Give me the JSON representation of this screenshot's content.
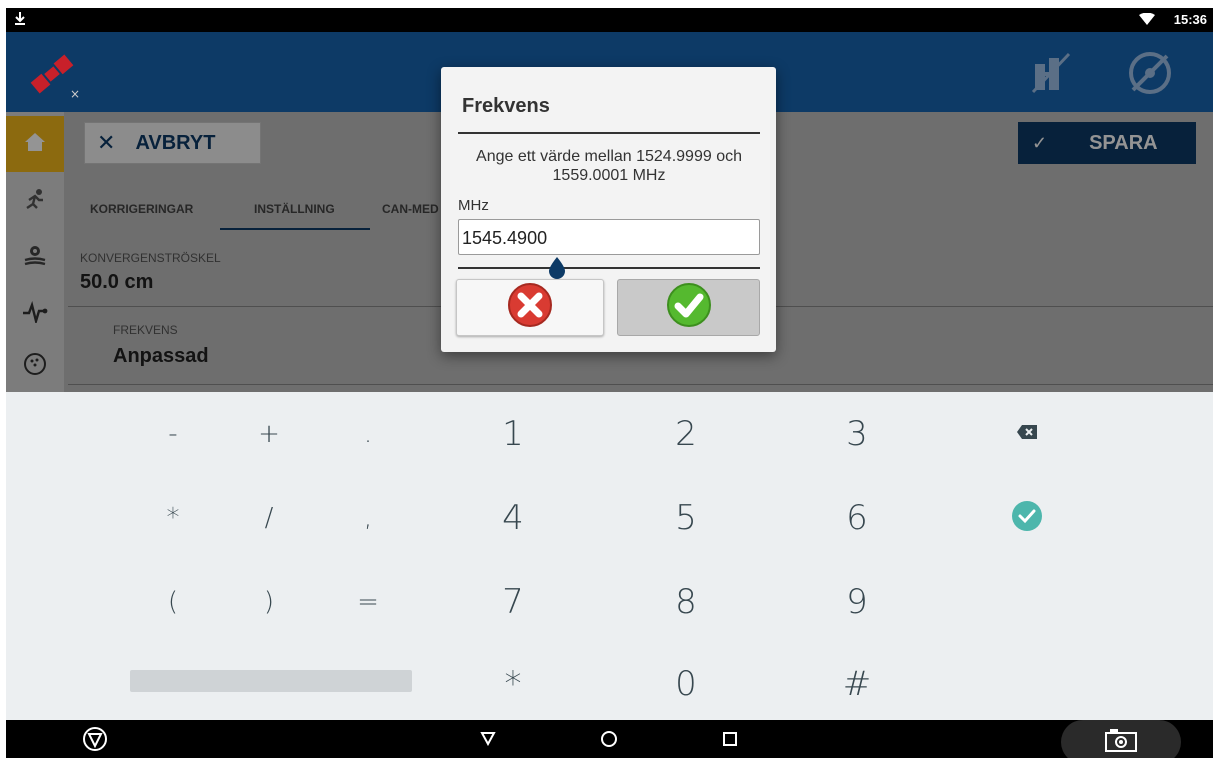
{
  "status_bar": {
    "time": "15:36"
  },
  "toolbar": {
    "cancel_label": "AVBRYT",
    "save_label": "SPARA"
  },
  "tabs": [
    {
      "label": "KORRIGERINGAR"
    },
    {
      "label": "INSTÄLLNING"
    },
    {
      "label": "CAN-MED"
    }
  ],
  "settings": {
    "convergence_label": "KONVERGENSTRÖSKEL",
    "convergence_value": "50.0 cm",
    "frequency_label": "FREKVENS",
    "frequency_value": "Anpassad"
  },
  "dialog": {
    "title": "Frekvens",
    "message": "Ange ett värde mellan 1524.9999 och 1559.0001 MHz",
    "unit": "MHz",
    "value": "1545.4900"
  },
  "keyboard": {
    "rows": [
      [
        "-",
        "+",
        ".",
        "1",
        "2",
        "3"
      ],
      [
        "*",
        "/",
        ",",
        "4",
        "5",
        "6"
      ],
      [
        "(",
        ")",
        "=",
        "7",
        "8",
        "9"
      ],
      [
        "",
        "",
        "",
        "*",
        "0",
        "#"
      ]
    ]
  },
  "colors": {
    "app_bar": "#0d3a66",
    "active_nav": "#f1b71a",
    "keyboard_bg": "#eceff1",
    "enter_key": "#4db6ac"
  }
}
